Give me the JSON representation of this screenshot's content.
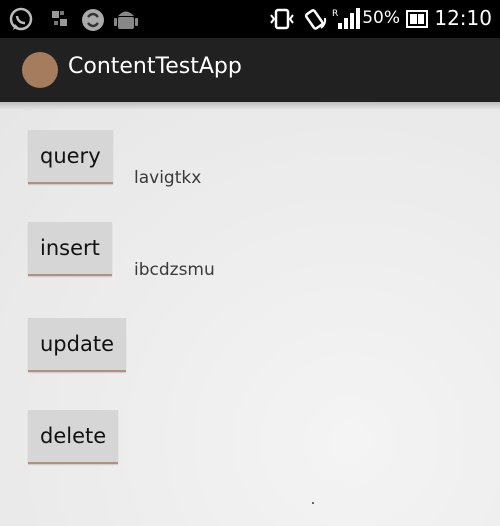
{
  "status_bar": {
    "battery_percent": "50%",
    "time": "12:10",
    "left_icons": [
      "whatsapp-icon",
      "sim-icon",
      "sync-icon",
      "android-debug-icon"
    ],
    "right_icons": [
      "vibrate-icon",
      "screen-rotation-icon",
      "signal-icon",
      "battery-icon"
    ],
    "signal_roaming": "R"
  },
  "action_bar": {
    "title": "ContentTestApp",
    "logo_color": "#a57c5e"
  },
  "buttons": {
    "query": "query",
    "insert": "insert",
    "update": "update",
    "delete": "delete"
  },
  "results": {
    "query": "lavigtkx",
    "insert": "ibcdzsmu"
  }
}
